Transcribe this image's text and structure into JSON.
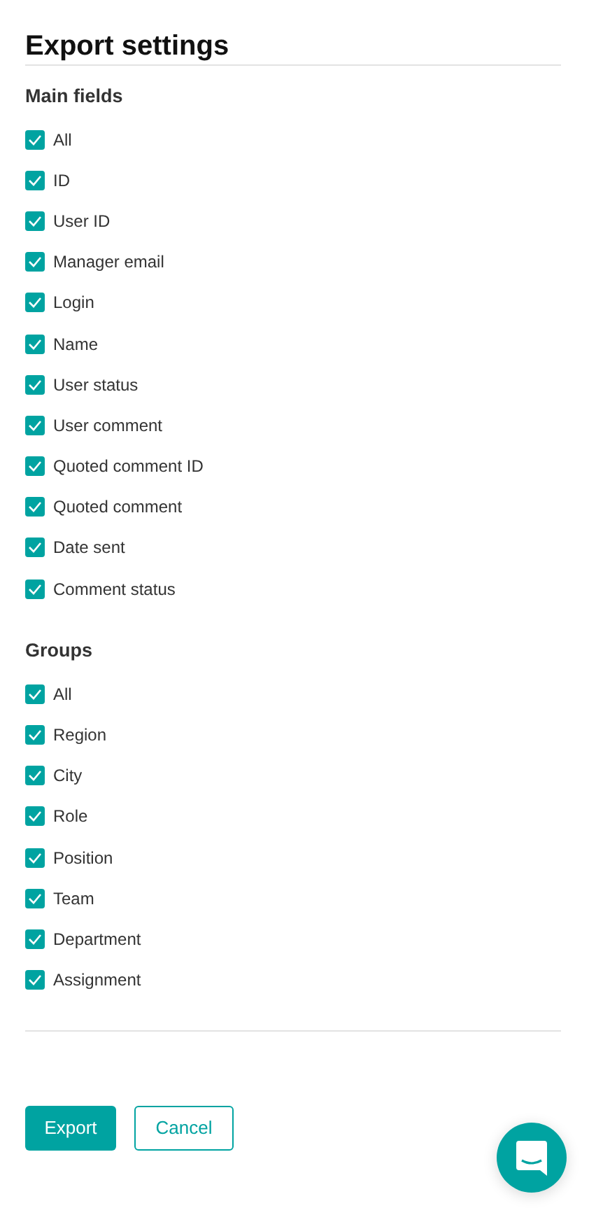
{
  "title": "Export settings",
  "sections": [
    {
      "heading": "Main fields",
      "items": [
        {
          "label": "All",
          "checked": true
        },
        {
          "label": "ID",
          "checked": true
        },
        {
          "label": "User ID",
          "checked": true
        },
        {
          "label": "Manager email",
          "checked": true
        },
        {
          "label": "Login",
          "checked": true
        },
        {
          "label": "Name",
          "checked": true
        },
        {
          "label": "User status",
          "checked": true
        },
        {
          "label": "User comment",
          "checked": true
        },
        {
          "label": "Quoted comment ID",
          "checked": true
        },
        {
          "label": "Quoted comment",
          "checked": true
        },
        {
          "label": "Date sent",
          "checked": true
        },
        {
          "label": "Comment status",
          "checked": true
        }
      ]
    },
    {
      "heading": "Groups",
      "items": [
        {
          "label": "All",
          "checked": true
        },
        {
          "label": "Region",
          "checked": true
        },
        {
          "label": "City",
          "checked": true
        },
        {
          "label": "Role",
          "checked": true
        },
        {
          "label": "Position",
          "checked": true
        },
        {
          "label": "Team",
          "checked": true
        },
        {
          "label": "Department",
          "checked": true
        },
        {
          "label": "Assignment",
          "checked": true
        }
      ]
    }
  ],
  "buttons": [
    {
      "label": "Export",
      "kind": "primary"
    },
    {
      "label": "Cancel",
      "kind": "secondary"
    }
  ]
}
